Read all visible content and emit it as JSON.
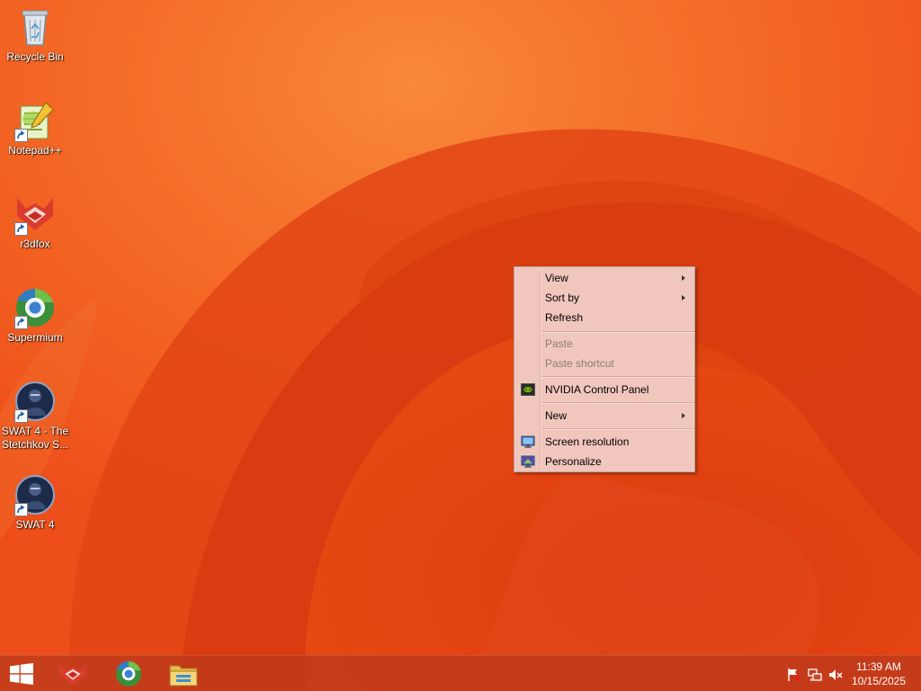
{
  "desktop": {
    "icons": [
      {
        "label": "Recycle Bin",
        "icon": "recycle-bin-icon"
      },
      {
        "label": "Notepad++",
        "icon": "notepad-plus-plus-icon"
      },
      {
        "label": "r3dfox",
        "icon": "r3dfox-icon"
      },
      {
        "label": "Supermium",
        "icon": "supermium-icon"
      },
      {
        "label": "SWAT 4 - The Stetchkov S...",
        "icon": "swat4-stetchkov-icon"
      },
      {
        "label": "SWAT 4",
        "icon": "swat4-icon"
      }
    ]
  },
  "context_menu": {
    "items": [
      {
        "label": "View",
        "submenu": true,
        "enabled": true
      },
      {
        "label": "Sort by",
        "submenu": true,
        "enabled": true
      },
      {
        "label": "Refresh",
        "submenu": false,
        "enabled": true
      },
      {
        "label": "Paste",
        "submenu": false,
        "enabled": false
      },
      {
        "label": "Paste shortcut",
        "submenu": false,
        "enabled": false
      },
      {
        "label": "NVIDIA Control Panel",
        "submenu": false,
        "enabled": true,
        "icon": "nvidia-icon"
      },
      {
        "label": "New",
        "submenu": true,
        "enabled": true
      },
      {
        "label": "Screen resolution",
        "submenu": false,
        "enabled": true,
        "icon": "screen-resolution-icon"
      },
      {
        "label": "Personalize",
        "submenu": false,
        "enabled": true,
        "icon": "personalize-icon"
      }
    ]
  },
  "taskbar": {
    "start_icon": "windows-logo-icon",
    "pinned": [
      {
        "name": "r3dfox",
        "icon": "r3dfox-icon"
      },
      {
        "name": "Supermium",
        "icon": "supermium-icon"
      },
      {
        "name": "File Explorer",
        "icon": "file-explorer-icon"
      }
    ],
    "tray_icons": [
      "action-center-flag-icon",
      "network-icon",
      "volume-muted-icon"
    ],
    "clock": {
      "time": "11:39 AM",
      "date": "10/15/2025"
    }
  },
  "colors": {
    "wallpaper_base": "#f0561d",
    "menu_background": "#f1c6bc",
    "taskbar": "#bc3a1c"
  }
}
